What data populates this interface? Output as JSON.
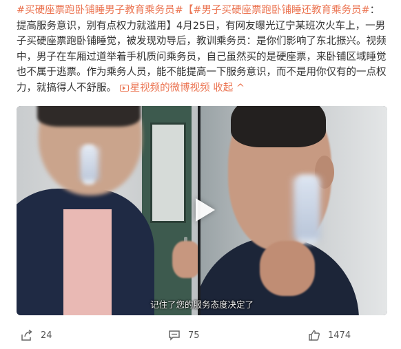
{
  "post": {
    "hashtag_1": "#买硬座票跑卧铺睡男子教育乘务员#",
    "hashtag_2": "【#男子买硬座票跑卧铺睡还教育乘务员#",
    "body_text": "：提高服务意识，别有点权力就滥用】4月25日，有网友曝光辽宁某班次火车上，一男子买硬座票跑卧铺睡觉，被发现劝导后，教训乘务员：是你们影响了东北振兴。视频中，男子在车厢过道举着手机质问乘务员，自己虽然买的是硬座票，来卧铺区域睡觉也不属于逃票。作为乘务人员，能不能提高一下服务意识，而不是用你仅有的一点权力，就搞得人不舒服。",
    "video_link_label": "星视频的微博视频",
    "collapse_label": "收起"
  },
  "video": {
    "subtitle": "记住了您的服务态度决定了"
  },
  "actions": {
    "share_count": "24",
    "comment_count": "75",
    "like_count": "1474"
  },
  "colors": {
    "accent": "#eb7350",
    "text": "#333333",
    "muted": "#555555"
  },
  "icons": {
    "video_link": "video-icon",
    "share": "share-icon",
    "comment": "comment-icon",
    "like": "like-icon",
    "play": "play-icon"
  }
}
